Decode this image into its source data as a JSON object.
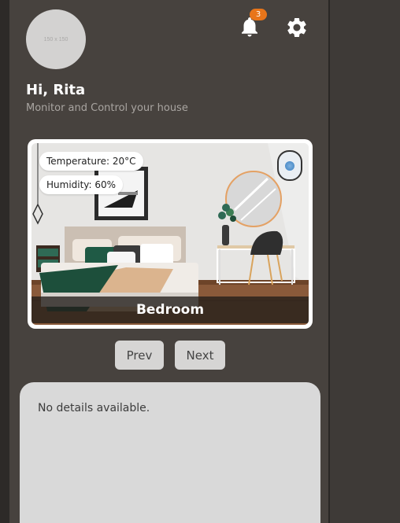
{
  "profile": {
    "avatar_placeholder": "150 x 150",
    "greeting": "Hi, Rita",
    "subtitle": "Monitor and Control your house"
  },
  "notifications": {
    "count": "3",
    "icon": "bell-icon"
  },
  "settings": {
    "icon": "gear-icon"
  },
  "room": {
    "name": "Bedroom",
    "temperature_label": "Temperature: 20°C",
    "humidity_label": "Humidity: 60%"
  },
  "navigation": {
    "prev_label": "Prev",
    "next_label": "Next"
  },
  "details": {
    "text": "No details available."
  },
  "colors": {
    "background": "#3e3a37",
    "panel": "#47423e",
    "badge": "#e8751a",
    "button": "#d6d5d4",
    "details_card": "#d9d9d9"
  }
}
